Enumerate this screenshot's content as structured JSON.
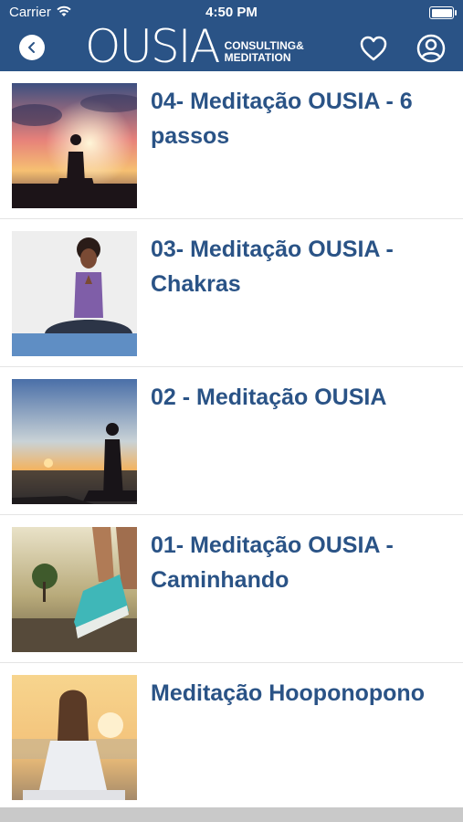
{
  "status": {
    "carrier": "Carrier",
    "time": "4:50 PM"
  },
  "header": {
    "logo_main": "OUSIA",
    "logo_line1": "CONSULTING&",
    "logo_line2": "MEDITATION",
    "back_icon": "chevron-left-icon",
    "favorites_icon": "heart-icon",
    "profile_icon": "user-circle-icon"
  },
  "colors": {
    "brand": "#2a5386",
    "title_text": "#2a5386",
    "divider": "#e4e4e4"
  },
  "items": [
    {
      "title": "04- Meditação OUSIA - 6 passos",
      "image": "silhouette-meditating-sunset-clouds"
    },
    {
      "title": "03- Meditação OUSIA - Chakras",
      "image": "woman-meditating-purple-top"
    },
    {
      "title": "02 - Meditação OUSIA",
      "image": "silhouette-meditating-beach-sunset"
    },
    {
      "title": "01- Meditação OUSIA - Caminhando",
      "image": "walking-sneakers-on-path"
    },
    {
      "title": "Meditação Hooponopono",
      "image": "woman-meditating-sunrise-back-view"
    }
  ]
}
